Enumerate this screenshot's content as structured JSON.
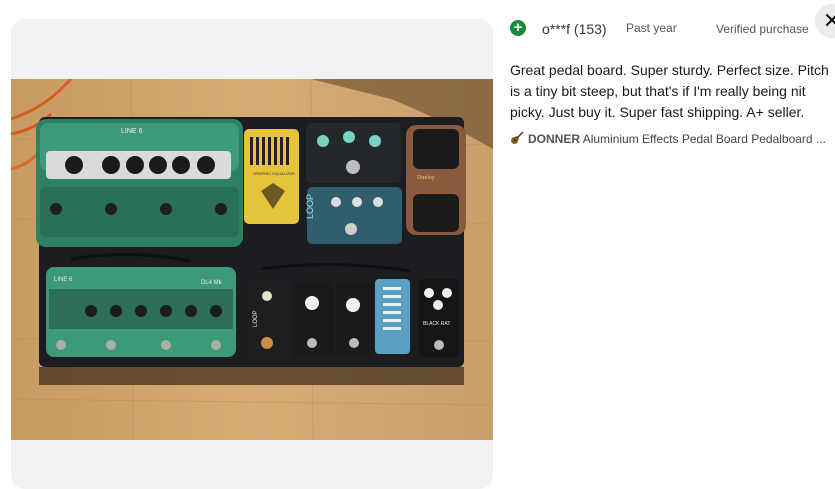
{
  "review": {
    "reviewer": "o***f (153)",
    "time": "Past year",
    "verified": "Verified purchase",
    "text": "Great pedal board. Super sturdy. Perfect size. Pitch is a tiny bit steep, but that's if I'm really being nit picky. Just buy it. Super fast shipping. A+ seller.",
    "feedback_icon": "positive-feedback-icon",
    "feedback_color": "#188b3d"
  },
  "product": {
    "brand": "DONNER",
    "title": "Aluminium Effects Pedal Board Pedalboard ...",
    "icon": "guitar-icon"
  },
  "photo": {
    "labels": {
      "line6_top": "LINE 6",
      "eq": "GRAPHIC EQUALIZER",
      "line6_bottom": "LINE 6",
      "dl4": "DL4 Mk",
      "loop_blue": "LOOP",
      "loop_small": "LOOP",
      "dunlop": "Dunlop",
      "rat": "BLACK RAT"
    }
  },
  "close_glyph": "✕"
}
